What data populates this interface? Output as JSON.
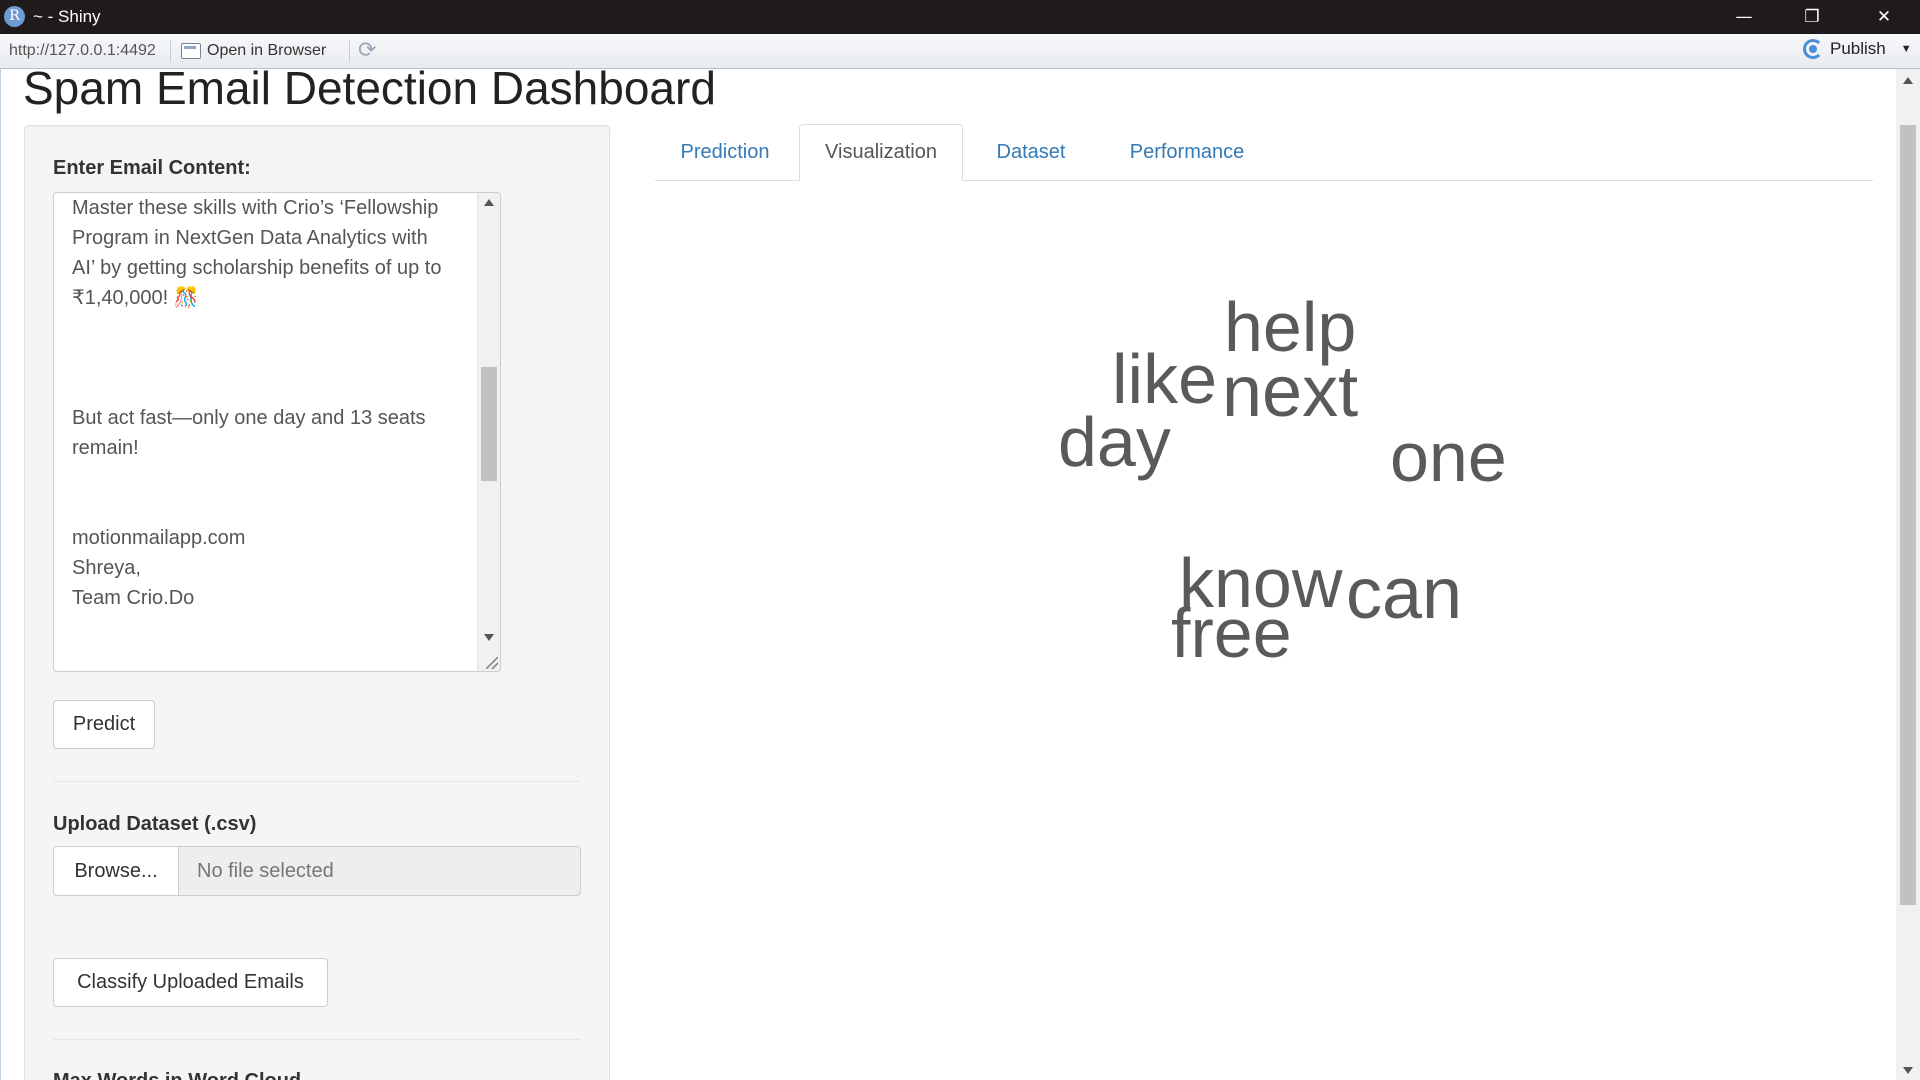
{
  "window": {
    "icon_letter": "R",
    "title": "~ - Shiny",
    "minimize_glyph": "—",
    "maximize_glyph": "❐",
    "close_glyph": "✕"
  },
  "toolbar": {
    "url": "http://127.0.0.1:4492",
    "open_in_browser": "Open in Browser",
    "refresh_glyph": "⟳",
    "publish": "Publish",
    "publish_caret": "▼"
  },
  "page": {
    "title": "Spam Email Detection Dashboard"
  },
  "sidebar": {
    "email_label": "Enter Email Content:",
    "email_paragraphs": [
      "Master these skills with Crio’s ‘Fellowship Program in NextGen Data Analytics with AI’ by getting scholarship benefits of up to ₹1,40,000! 🎊",
      "But act fast—only one day and 13 seats remain!",
      "motionmailapp.com",
      "Shreya,",
      "Team Crio.Do"
    ],
    "predict_button": "Predict",
    "upload_label": "Upload Dataset (.csv)",
    "browse_button": "Browse...",
    "file_placeholder": "No file selected",
    "classify_button": "Classify Uploaded Emails",
    "next_section_label": "Max Words in Word Cloud"
  },
  "tabs": [
    {
      "label": "Prediction",
      "active": false
    },
    {
      "label": "Visualization",
      "active": true
    },
    {
      "label": "Dataset",
      "active": false
    },
    {
      "label": "Performance",
      "active": false
    }
  ],
  "word_cloud": {
    "color": "#5a5a5a",
    "words": [
      "help",
      "like",
      "next",
      "day",
      "one",
      "know",
      "can",
      "free"
    ]
  }
}
